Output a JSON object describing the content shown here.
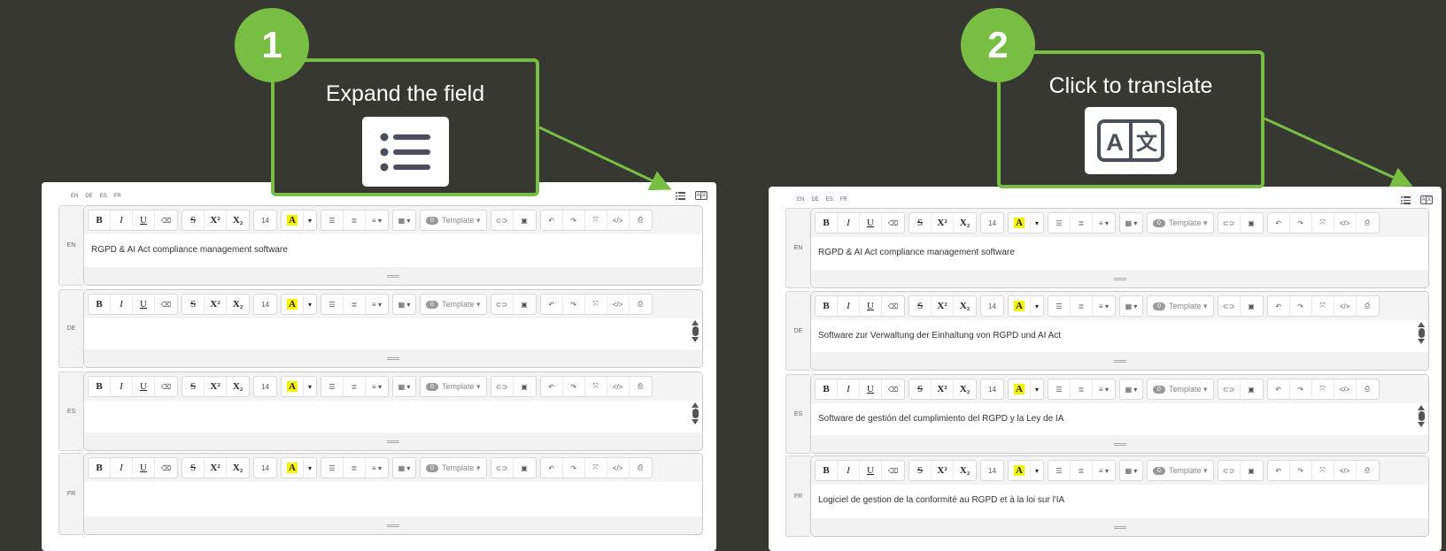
{
  "colors": {
    "accent_green": "#77be43",
    "background": "#383833",
    "highlight_yellow": "#f5f500"
  },
  "toolbar": {
    "bold": "B",
    "italic": "I",
    "underline": "U",
    "eraser": "⌫",
    "strike": "S",
    "superscript": "X²",
    "subscript": "X₂",
    "font_size": "14",
    "highlight": "A",
    "caret": "▾",
    "ul_icon": "☰",
    "ol_icon": "≣",
    "align_icon": "≡ ▾",
    "table_icon": "▦ ▾",
    "template_count": "0",
    "template_label": "Template ▾",
    "link_icon": "⊂⊃",
    "image_icon": "▣",
    "undo_icon": "↶",
    "redo_icon": "↷",
    "fullscreen_icon": "⤧",
    "code_icon": "</>",
    "print_icon": "⎙"
  },
  "step1": {
    "number": "1",
    "title": "Expand the field",
    "lang_links": [
      "EN",
      "DE",
      "ES",
      "FR"
    ],
    "rows": [
      {
        "lang": "EN",
        "text": "RGPD & AI Act compliance management software"
      },
      {
        "lang": "DE",
        "text": ""
      },
      {
        "lang": "ES",
        "text": ""
      },
      {
        "lang": "FR",
        "text": ""
      }
    ]
  },
  "step2": {
    "number": "2",
    "title": "Click to translate",
    "translate_icon_letters": [
      "A",
      "文"
    ],
    "lang_links": [
      "EN",
      "DE",
      "ES",
      "FR"
    ],
    "rows": [
      {
        "lang": "EN",
        "text": "RGPD & AI Act compliance management software"
      },
      {
        "lang": "DE",
        "text": "Software zur Verwaltung der Einhaltung von RGPD und AI Act"
      },
      {
        "lang": "ES",
        "text": "Software de gestión del cumplimiento del RGPD y la Ley de IA"
      },
      {
        "lang": "FR",
        "text": "Logiciel de gestion de la conformité au RGPD et à la loi sur l'IA"
      }
    ]
  }
}
